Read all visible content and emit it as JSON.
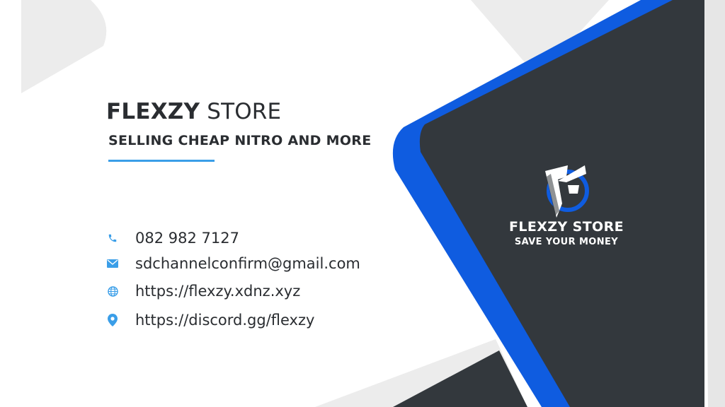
{
  "card": {
    "title_bold": "FLEXZY",
    "title_light": " STORE",
    "tagline": "SELLING CHEAP NITRO AND MORE",
    "contacts": [
      {
        "icon": "phone-icon",
        "text": "082 982 7127"
      },
      {
        "icon": "email-icon",
        "text": "sdchannelconfirm@gmail.com"
      },
      {
        "icon": "globe-icon",
        "text": "https://flexzy.xdnz.xyz"
      },
      {
        "icon": "location-pin-icon",
        "text": "https://discord.gg/flexzy"
      }
    ],
    "brand": {
      "name": "FLEXZY STORE",
      "slogan": "SAVE YOUR MONEY",
      "logo_icon": "flexzy-logo-icon"
    }
  },
  "colors": {
    "dark_panel": "#33383d",
    "blue_accent": "#0f5ce0",
    "light_blue": "#3a9ee8",
    "text_dark": "#2a2d31",
    "light_gray": "#ececec"
  }
}
